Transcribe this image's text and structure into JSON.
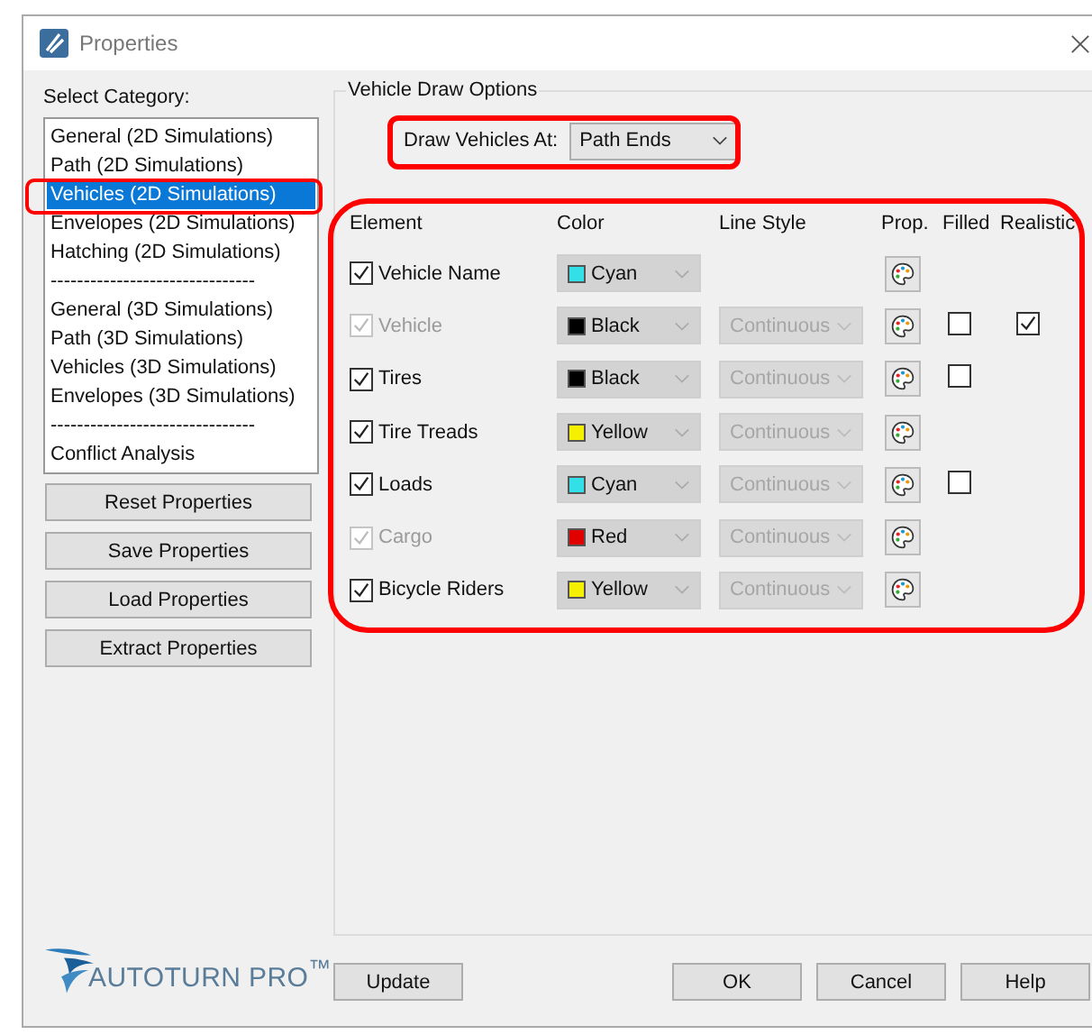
{
  "window": {
    "title": "Properties"
  },
  "category_label": "Select Category:",
  "categories": [
    {
      "kind": "item",
      "label": "General (2D Simulations)",
      "selected": false
    },
    {
      "kind": "item",
      "label": "Path (2D Simulations)",
      "selected": false
    },
    {
      "kind": "item",
      "label": "Vehicles (2D Simulations)",
      "selected": true
    },
    {
      "kind": "item",
      "label": "Envelopes (2D Simulations)",
      "selected": false
    },
    {
      "kind": "item",
      "label": "Hatching (2D Simulations)",
      "selected": false
    },
    {
      "kind": "separator",
      "label": "-------------------------------"
    },
    {
      "kind": "item",
      "label": "General (3D Simulations)",
      "selected": false
    },
    {
      "kind": "item",
      "label": "Path (3D Simulations)",
      "selected": false
    },
    {
      "kind": "item",
      "label": "Vehicles (3D Simulations)",
      "selected": false
    },
    {
      "kind": "item",
      "label": "Envelopes (3D Simulations)",
      "selected": false
    },
    {
      "kind": "separator",
      "label": "-------------------------------"
    },
    {
      "kind": "item",
      "label": "Conflict Analysis",
      "selected": false
    }
  ],
  "side_buttons": [
    "Reset Properties",
    "Save Properties",
    "Load Properties",
    "Extract Properties"
  ],
  "group": {
    "title": "Vehicle Draw Options",
    "draw_at_label": "Draw Vehicles At:",
    "draw_at_value": "Path Ends"
  },
  "columns": [
    "Element",
    "Color",
    "Line Style",
    "Prop.",
    "Filled",
    "Realistic"
  ],
  "rows": [
    {
      "label": "Vehicle Name",
      "checked": true,
      "disabled": false,
      "color_name": "Cyan",
      "color": "#33e0e8"
    },
    {
      "label": "Vehicle",
      "checked": true,
      "disabled": true,
      "color_name": "Black",
      "color": "#000000",
      "line_style": "Continuous",
      "filled": false,
      "realistic": true
    },
    {
      "label": "Tires",
      "checked": true,
      "disabled": false,
      "color_name": "Black",
      "color": "#000000",
      "line_style": "Continuous",
      "filled": false
    },
    {
      "label": "Tire Treads",
      "checked": true,
      "disabled": false,
      "color_name": "Yellow",
      "color": "#f5f000",
      "line_style": "Continuous"
    },
    {
      "label": "Loads",
      "checked": true,
      "disabled": false,
      "color_name": "Cyan",
      "color": "#33e0e8",
      "line_style": "Continuous",
      "filled": false
    },
    {
      "label": "Cargo",
      "checked": true,
      "disabled": true,
      "color_name": "Red",
      "color": "#e00000",
      "line_style": "Continuous"
    },
    {
      "label": "Bicycle Riders",
      "checked": true,
      "disabled": false,
      "color_name": "Yellow",
      "color": "#f5f000",
      "line_style": "Continuous"
    }
  ],
  "logo": "AUTOTURN PRO$^{™}$",
  "footer_buttons": [
    "Update",
    "OK",
    "Cancel",
    "Help"
  ]
}
